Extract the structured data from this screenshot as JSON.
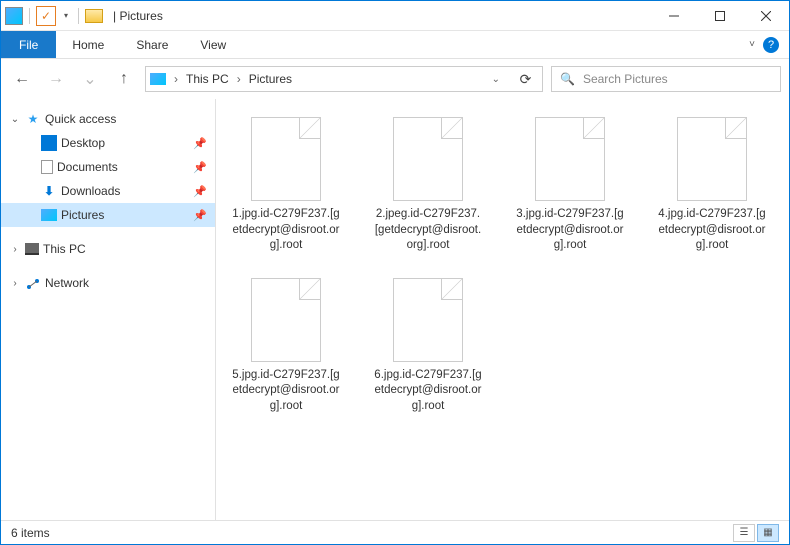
{
  "titlebar": {
    "window_title": "Pictures",
    "qa_down": "▾"
  },
  "ribbon": {
    "file": "File",
    "tabs": [
      "Home",
      "Share",
      "View"
    ],
    "expand": "˅",
    "help": "?"
  },
  "address": {
    "back": "←",
    "forward": "→",
    "up": "↑",
    "crumbs": [
      "This PC",
      "Pictures"
    ],
    "sep": "›",
    "dropdown": "⌄",
    "refresh": "⟳"
  },
  "search": {
    "icon": "🔍",
    "placeholder": "Search Pictures"
  },
  "sidebar": {
    "quick_access": "Quick access",
    "items": [
      {
        "label": "Desktop",
        "icon": "desktop",
        "pinned": true
      },
      {
        "label": "Documents",
        "icon": "doc",
        "pinned": true
      },
      {
        "label": "Downloads",
        "icon": "down",
        "pinned": true
      },
      {
        "label": "Pictures",
        "icon": "pic",
        "pinned": true,
        "selected": true
      }
    ],
    "this_pc": "This PC",
    "network": "Network"
  },
  "files": [
    {
      "name": "1.jpg.id-C279F237.[getdecrypt@disroot.org].root"
    },
    {
      "name": "2.jpeg.id-C279F237.[getdecrypt@disroot.org].root"
    },
    {
      "name": "3.jpg.id-C279F237.[getdecrypt@disroot.org].root"
    },
    {
      "name": "4.jpg.id-C279F237.[getdecrypt@disroot.org].root"
    },
    {
      "name": "5.jpg.id-C279F237.[getdecrypt@disroot.org].root"
    },
    {
      "name": "6.jpg.id-C279F237.[getdecrypt@disroot.org].root"
    }
  ],
  "statusbar": {
    "count_label": "6 items"
  }
}
